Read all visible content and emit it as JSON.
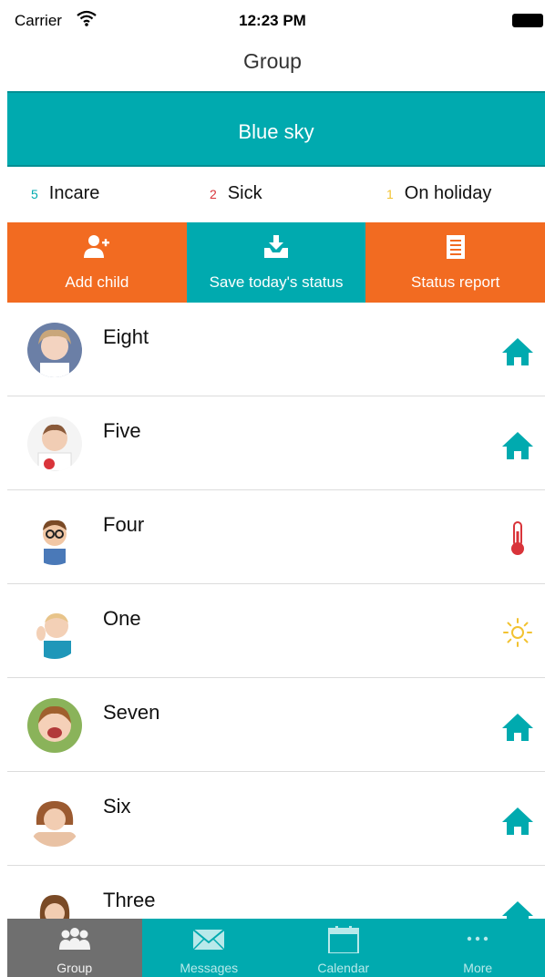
{
  "status_bar": {
    "carrier": "Carrier",
    "time": "12:23 PM"
  },
  "nav": {
    "title": "Group"
  },
  "group": {
    "name": "Blue sky"
  },
  "summary": [
    {
      "count": "5",
      "label": "Incare",
      "color": "#00aaaf"
    },
    {
      "count": "2",
      "label": "Sick",
      "color": "#d9343a"
    },
    {
      "count": "1",
      "label": "On holiday",
      "color": "#f2c230"
    }
  ],
  "actions": [
    {
      "label": "Add child",
      "icon": "add-user-icon",
      "color": "#f26b21"
    },
    {
      "label": "Save today's status",
      "icon": "download-tray-icon",
      "color": "#00aaaf"
    },
    {
      "label": "Status report",
      "icon": "document-icon",
      "color": "#f26b21"
    }
  ],
  "children": [
    {
      "name": "Eight",
      "status": "incare",
      "status_icon": "home-icon"
    },
    {
      "name": "Five",
      "status": "incare",
      "status_icon": "home-icon"
    },
    {
      "name": "Four",
      "status": "sick",
      "status_icon": "thermometer-icon"
    },
    {
      "name": "One",
      "status": "holiday",
      "status_icon": "sun-icon"
    },
    {
      "name": "Seven",
      "status": "incare",
      "status_icon": "home-icon"
    },
    {
      "name": "Six",
      "status": "incare",
      "status_icon": "home-icon"
    },
    {
      "name": "Three",
      "status": "incare",
      "status_icon": "home-icon"
    }
  ],
  "tabs": [
    {
      "label": "Group",
      "icon": "group-icon",
      "active": true
    },
    {
      "label": "Messages",
      "icon": "envelope-icon",
      "active": false
    },
    {
      "label": "Calendar",
      "icon": "calendar-icon",
      "active": false
    },
    {
      "label": "More",
      "icon": "more-dots-icon",
      "active": false
    }
  ],
  "colors": {
    "teal": "#00aaaf",
    "orange": "#f26b21",
    "tab_active": "#6f6f6f",
    "sick_red": "#d9343a",
    "holiday_yellow": "#f2c230"
  }
}
